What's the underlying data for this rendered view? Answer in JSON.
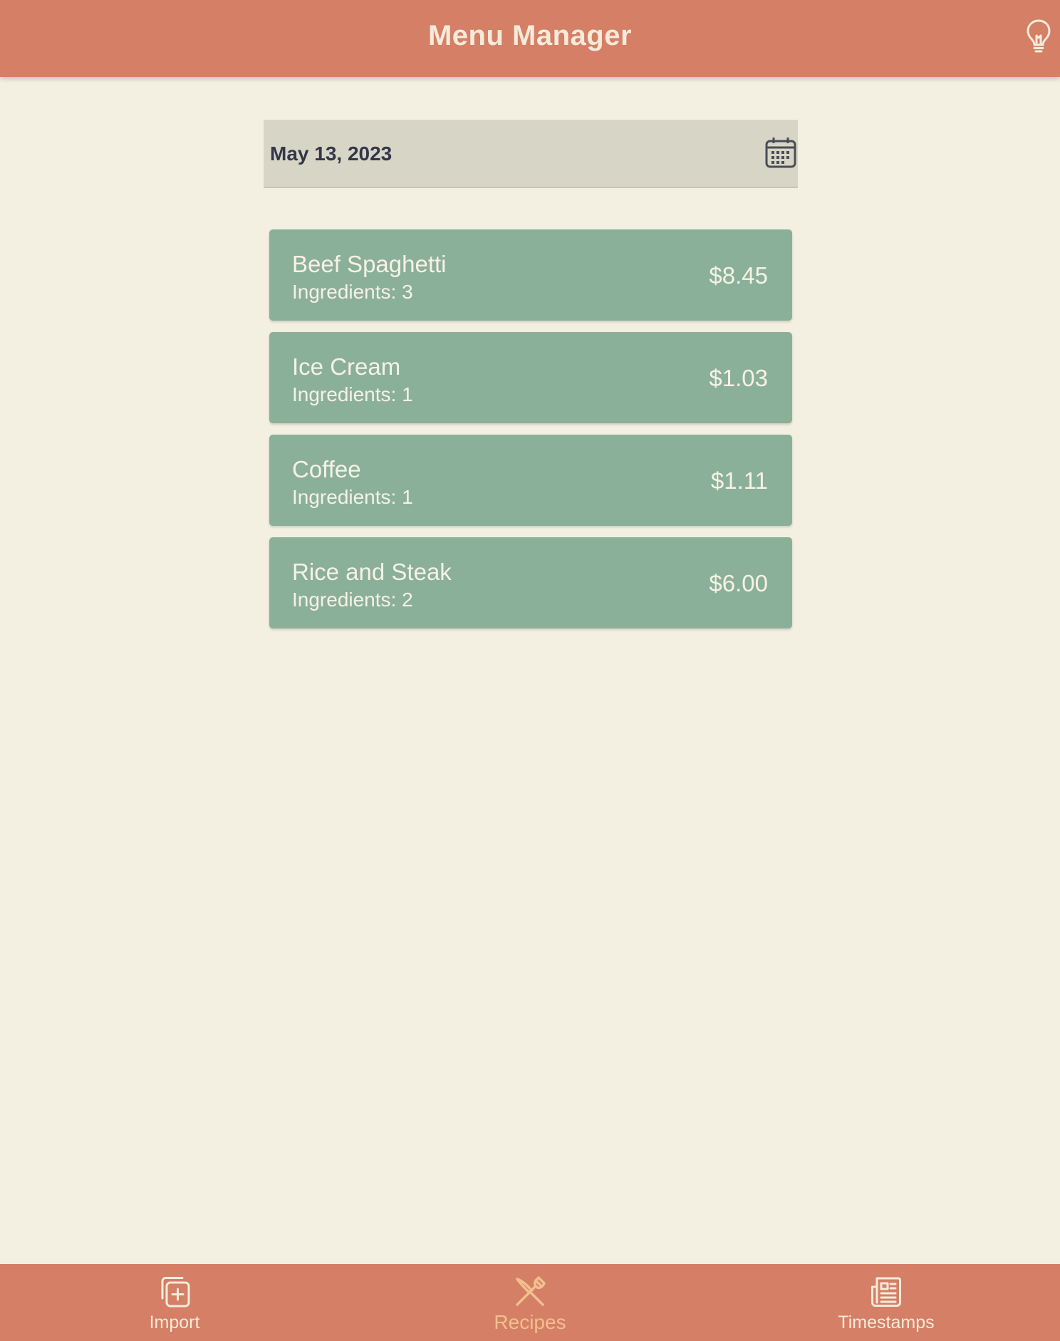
{
  "header": {
    "title": "Menu Manager",
    "tip_icon": "lightbulb-icon"
  },
  "date_field": {
    "value": "May 13, 2023",
    "icon": "calendar-icon"
  },
  "recipes": [
    {
      "name": "Beef Spaghetti",
      "ingredients": "Ingredients: 3",
      "price": "$8.45"
    },
    {
      "name": "Ice Cream",
      "ingredients": "Ingredients: 1",
      "price": "$1.03"
    },
    {
      "name": "Coffee",
      "ingredients": "Ingredients: 1",
      "price": "$1.11"
    },
    {
      "name": "Rice and Steak",
      "ingredients": "Ingredients: 2",
      "price": "$6.00"
    }
  ],
  "bottom_nav": {
    "items": [
      {
        "label": "Import",
        "icon": "add-copy-icon",
        "active": false
      },
      {
        "label": "Recipes",
        "icon": "fork-knife-icon",
        "active": true
      },
      {
        "label": "Timestamps",
        "icon": "newspaper-icon",
        "active": false
      }
    ]
  },
  "colors": {
    "primary": "#D47F66",
    "background": "#F3F0E1",
    "card": "#8BB09A",
    "field": "#D7D5C5",
    "active_nav": "#F2C08E",
    "header_text": "#F6EBDA"
  }
}
